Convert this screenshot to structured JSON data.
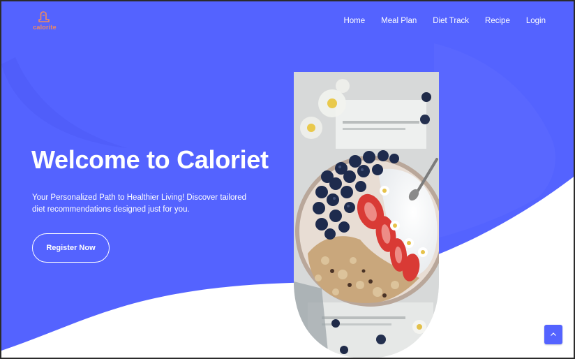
{
  "brand": {
    "name": "calorite",
    "color": "#f08a5d"
  },
  "nav": {
    "items": [
      {
        "label": "Home"
      },
      {
        "label": "Meal Plan"
      },
      {
        "label": "Diet Track"
      },
      {
        "label": "Recipe"
      },
      {
        "label": "Login"
      }
    ]
  },
  "hero": {
    "title": "Welcome to Caloriet",
    "subtitle": "Your Personalized Path to Healthier Living! Discover tailored diet recommendations designed just for you.",
    "cta_label": "Register Now",
    "image_icon": "food-bowl-photo"
  },
  "back_to_top": {
    "icon": "chevron-up-icon"
  },
  "colors": {
    "primary": "#5463ff",
    "primary_light": "#6a77ff",
    "text_on_primary": "#ffffff",
    "background": "#ffffff"
  }
}
